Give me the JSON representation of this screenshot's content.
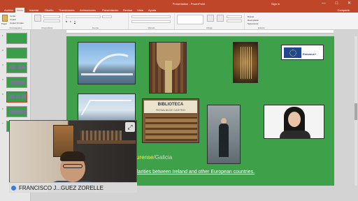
{
  "window": {
    "title": "Presentation - PowerPoint",
    "account": "Sign in",
    "controls": "— □ ✕",
    "accent": "#c0462a"
  },
  "ribbon": {
    "tabs": [
      "Archivo",
      "Inicio",
      "Insertar",
      "Diseño",
      "Transiciones",
      "Animaciones",
      "Presentación",
      "Revisar",
      "Vista",
      "Ayuda"
    ],
    "share": "Compartir",
    "clipboard": {
      "paste": "Pegar",
      "cut": "Cortar",
      "copy": "Copiar",
      "format": "Copiar formato",
      "label": "Portapapeles"
    },
    "slides_label": "Diapositivas",
    "font_label": "Fuente",
    "paragraph_label": "Párrafo",
    "drawing_label": "Dibujo",
    "editing_label": "Edición",
    "find": "Buscar",
    "replace": "Reemplazar",
    "select": "Seleccionar"
  },
  "thumbnails": [
    "1",
    "2",
    "3",
    "4",
    "5",
    "6",
    "7"
  ],
  "slide": {
    "background": "#3ea048",
    "logo_text": "Erasmus+",
    "biblioteca_title": "BIBLIOTECA",
    "biblioteca_sub": "ROSALÍA DE CASTRO",
    "subtitle_part1": "urense",
    "subtitle_sep": "/",
    "subtitle_part2": "Galicia",
    "note": "larities between Ireland and other European countries."
  },
  "video_call": {
    "participant": "FRANCISCO J...GUEZ ZORELLE",
    "expand_icon": "⤢"
  }
}
